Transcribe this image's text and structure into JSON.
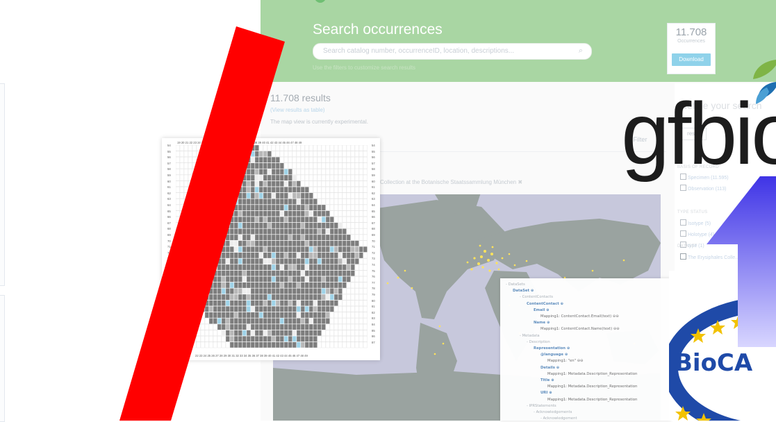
{
  "portal": {
    "title": "Search occurrences",
    "search_placeholder": "Search catalog number, occurrenceID, location, descriptions...",
    "filters_hint": "Use the filters to customize search results",
    "occurrence_count": "11.708",
    "occurrence_label": "Occurrences",
    "download_label": "Download",
    "results_heading": "11.708 results",
    "view_table_link": "(View results as table)",
    "map_note": "The map view is currently experimental.",
    "filter_link": "Filter",
    "dataset_chip": "Collection at the Botanische Staatssammlung München"
  },
  "refine": {
    "title": "Refine your search",
    "reset_label": "reset",
    "basis_heading": "BASIS OF RECORD",
    "basis_options": [
      "Specimen (11.595)",
      "Observation (113)"
    ],
    "type_heading": "TYPE STATUS",
    "type_options": [
      "Isotype (5)",
      "Holotype (4)",
      "type (1)"
    ],
    "dataset_heading": "DATASET",
    "dataset_option": "The Erysiphales Colle... (11.708)"
  },
  "grid_map": {
    "top_numbers": "19 20 21 22 23 24 25 26 27 28 29 30 31 32 33 34 35 36 37 38 39 40 41 42 43 44 45 46 47 48 49",
    "bottom_numbers": "22 23 24 25 26 27 28 29 30 31 32 33 34 35 36 37 38 39 40 41 42 43 44 45 46 47 48 49",
    "left_numbers": [
      "54",
      "55",
      "56",
      "57",
      "58",
      "59",
      "60",
      "61",
      "62",
      "63",
      "64",
      "65",
      "66",
      "67",
      "68",
      "69",
      "70",
      "71",
      "72",
      "73",
      "74",
      "75",
      "76",
      "77",
      "78",
      "79",
      "80",
      "81",
      "82",
      "83",
      "84",
      "85",
      "86",
      "87"
    ]
  },
  "xml_tree": {
    "lines": [
      {
        "indent": 0,
        "kind": "node",
        "text": "- DataSets"
      },
      {
        "indent": 1,
        "kind": "elem",
        "text": "DataSet ⊕"
      },
      {
        "indent": 2,
        "kind": "node",
        "text": "- ContentContacts"
      },
      {
        "indent": 3,
        "kind": "elem",
        "text": "ContentContact ⊕"
      },
      {
        "indent": 4,
        "kind": "elem",
        "text": "Email ⊕"
      },
      {
        "indent": 5,
        "kind": "map",
        "text": "Mapping1: ContentContact.Email(text)   ⊝⊝"
      },
      {
        "indent": 4,
        "kind": "elem",
        "text": "Name ⊕"
      },
      {
        "indent": 5,
        "kind": "map",
        "text": "Mapping1: ContentContact.Name(text)   ⊝⊝"
      },
      {
        "indent": 2,
        "kind": "node",
        "text": "- Metadata"
      },
      {
        "indent": 3,
        "kind": "node",
        "text": "- Description"
      },
      {
        "indent": 4,
        "kind": "elem",
        "text": "Representation ⊕"
      },
      {
        "indent": 5,
        "kind": "elem",
        "text": "@language ⊕"
      },
      {
        "indent": 6,
        "kind": "map",
        "text": "Mapping1: \"en\"   ⊝⊝"
      },
      {
        "indent": 5,
        "kind": "elem",
        "text": "Details ⊕"
      },
      {
        "indent": 6,
        "kind": "map",
        "text": "Mapping1: Metadata.Description_Representation"
      },
      {
        "indent": 5,
        "kind": "elem",
        "text": "Title ⊕"
      },
      {
        "indent": 6,
        "kind": "map",
        "text": "Mapping1: Metadata.Description_Representation"
      },
      {
        "indent": 5,
        "kind": "elem",
        "text": "URI ⊕"
      },
      {
        "indent": 6,
        "kind": "map",
        "text": "Mapping1: Metadata.Description_Representation"
      },
      {
        "indent": 3,
        "kind": "node",
        "text": "- IPRStatements"
      },
      {
        "indent": 4,
        "kind": "node",
        "text": "- Acknowledgements"
      },
      {
        "indent": 5,
        "kind": "node",
        "text": "- Acknowledgement"
      }
    ]
  },
  "logos": {
    "gfbio_text": "gfbio",
    "biocase_text": "BioCA"
  },
  "colors": {
    "hero_green": "#a9d6a3",
    "slash_red": "#ff0000",
    "arrow_blue": "#5f55f0",
    "biocase_blue": "#1f4aa8",
    "biocase_star": "#f2c200",
    "ocean": "#c7c8dc",
    "land": "#9aa3a0",
    "occurrence_dot": "#ffe35a"
  }
}
